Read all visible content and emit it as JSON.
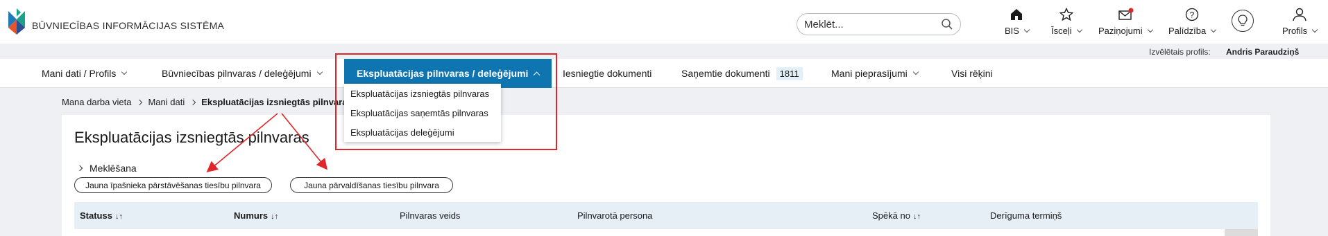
{
  "app": {
    "logo_text": "BŪVNIECĪBAS INFORMĀCIJAS SISTĒMA",
    "logo_colors": [
      "#1e7bb8",
      "#1aa38a",
      "#e8542a",
      "#2e4f8f"
    ]
  },
  "search": {
    "placeholder": "Meklēt..."
  },
  "header_items": [
    {
      "label": "BIS",
      "icon": "home-icon"
    },
    {
      "label": "Īsceļi",
      "icon": "star-icon"
    },
    {
      "label": "Paziņojumi",
      "icon": "envelope-icon"
    },
    {
      "label": "Palīdzība",
      "icon": "question-icon"
    },
    {
      "label": "Profils",
      "icon": "user-icon"
    }
  ],
  "profile": {
    "label": "Izvēlētais profils:",
    "name": "Andris Paraudziņš"
  },
  "nav": {
    "items": [
      {
        "label": "Mani dati / Profils",
        "has_chevron": true
      },
      {
        "label": "Būvniecības pilnvaras / deleģējumi",
        "has_chevron": true
      },
      {
        "label": "Ekspluatācijas pilnvaras / deleģējumi",
        "active": true
      },
      {
        "label": "Iesniegtie dokumenti"
      },
      {
        "label": "Saņemtie dokumenti",
        "badge": "1811"
      },
      {
        "label": "Mani pieprasījumi",
        "has_chevron": true
      },
      {
        "label": "Visi rēķini"
      }
    ],
    "dropdown": [
      "Ekspluatācijas izsniegtās pilnvaras",
      "Ekspluatācijas saņemtās pilnvaras",
      "Ekspluatācijas deleģējumi"
    ]
  },
  "breadcrumb": [
    "Mana darba vieta",
    "Mani dati",
    "Ekspluatācijas izsniegtās pilnvaras"
  ],
  "page": {
    "title": "Ekspluatācijas izsniegtās pilnvaras",
    "search_toggle": "Meklēšana",
    "buttons": {
      "owner_rep": "Jauna īpašnieka pārstāvēšanas tiesību pilnvara",
      "management": "Jauna pārvaldīšanas tiesību pilnvara"
    }
  },
  "table": {
    "columns": [
      "Statuss",
      "Numurs",
      "Pilnvaras veids",
      "Pilnvarotā persona",
      "Spēkā no",
      "Derīguma termiņš"
    ],
    "sort_symbol": "↓↑"
  },
  "colors": {
    "accent": "#0f75b0",
    "annotation": "#e0262a",
    "badge_bg": "#e3f0f8"
  }
}
